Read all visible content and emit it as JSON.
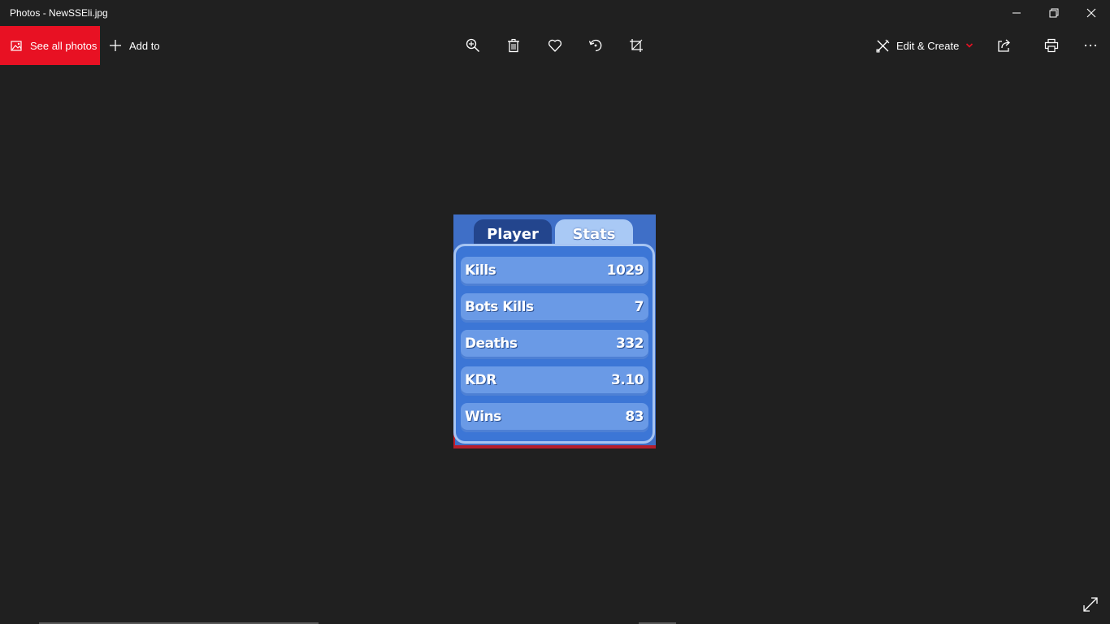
{
  "window": {
    "title": "Photos - NewSSEli.jpg",
    "controls": [
      "minimize-icon",
      "restore-icon",
      "close-icon"
    ]
  },
  "toolbar": {
    "see_all_label": "See all photos",
    "add_to_label": "Add to",
    "edit_create_label": "Edit & Create",
    "icons": [
      "zoom-in-icon",
      "delete-icon",
      "favorite-icon",
      "rotate-icon",
      "crop-icon",
      "share-icon",
      "print-icon",
      "more-icon"
    ],
    "accent_color": "#e81123"
  },
  "photo": {
    "tabs": [
      "Player",
      "Stats"
    ],
    "stats": [
      {
        "label": "Kills",
        "value": "1029"
      },
      {
        "label": "Bots Kills",
        "value": "7"
      },
      {
        "label": "Deaths",
        "value": "332"
      },
      {
        "label": "KDR",
        "value": "3.10"
      },
      {
        "label": "Wins",
        "value": "83"
      }
    ]
  }
}
